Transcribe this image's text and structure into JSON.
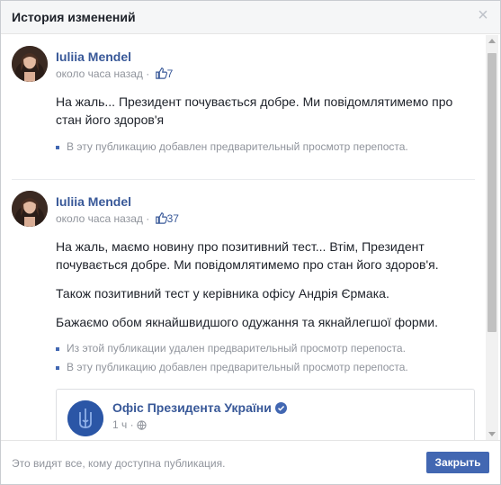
{
  "header": {
    "title": "История изменений",
    "close_glyph": "×"
  },
  "posts": [
    {
      "author": "Iuliia Mendel",
      "time": "около часа назад",
      "separator": "·",
      "likes": "7",
      "paragraphs": [
        "На жаль... Президент почувається добре. Ми повідомлятимемо про стан його здоров'я"
      ],
      "changes": [
        "В эту публикацию добавлен предварительный просмотр перепоста."
      ]
    },
    {
      "author": "Iuliia Mendel",
      "time": "около часа назад",
      "separator": "·",
      "likes": "37",
      "paragraphs": [
        "На жаль, маємо новину про позитивний тест... Втім, Президент почувається добре. Ми повідомлятимемо про стан його здоров'я.",
        "Також позитивний тест у керівника офісу Андрія Єрмака.",
        "Бажаємо обом якнайшвидшого одужання та якнайлегшої форми."
      ],
      "changes": [
        "Из этой публикации удален предварительный просмотр перепоста.",
        "В эту публикацию добавлен предварительный просмотр перепоста."
      ]
    }
  ],
  "shared_card": {
    "page_name": "Офіс Президента України",
    "time": "1 ч",
    "separator": "·"
  },
  "footer": {
    "visibility_text": "Это видят все, кому доступна публикация.",
    "close_label": "Закрыть"
  },
  "colors": {
    "accent": "#4267b2",
    "link": "#385898",
    "muted": "#90949c"
  },
  "icons": [
    "close-icon",
    "like-icon",
    "verified-badge-icon",
    "globe-icon",
    "trident-icon"
  ]
}
